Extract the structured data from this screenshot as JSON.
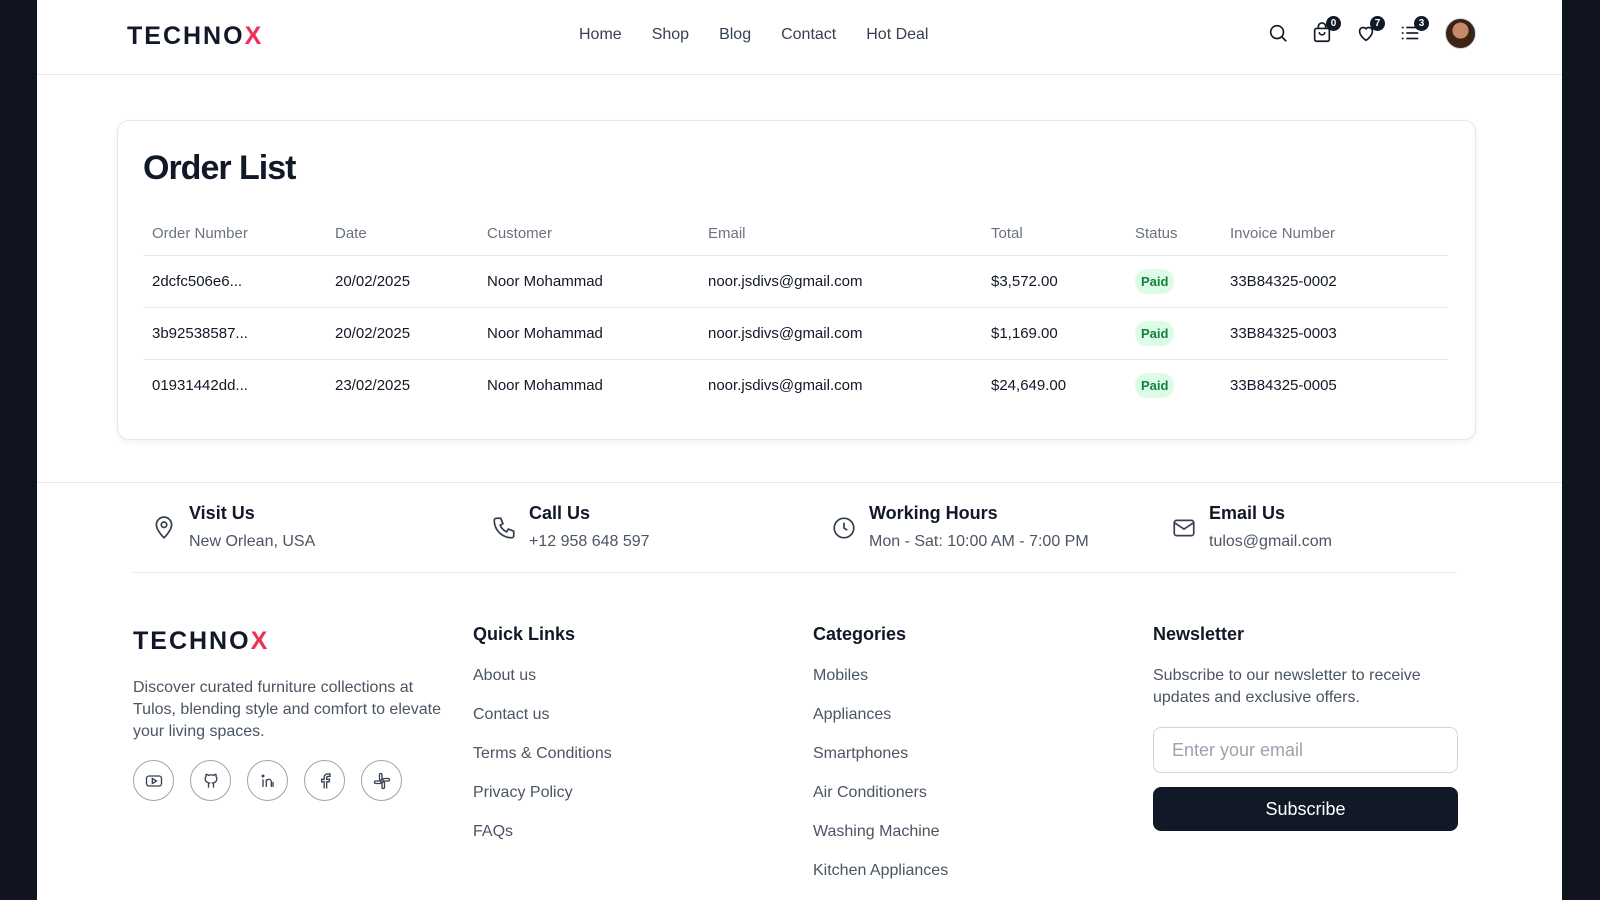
{
  "header": {
    "logo_main": "TECHNO",
    "logo_accent": "X",
    "nav": [
      "Home",
      "Shop",
      "Blog",
      "Contact",
      "Hot Deal"
    ],
    "cart_count": "0",
    "wishlist_count": "7",
    "compare_count": "3"
  },
  "orders": {
    "title": "Order List",
    "columns": [
      "Order Number",
      "Date",
      "Customer",
      "Email",
      "Total",
      "Status",
      "Invoice Number"
    ],
    "rows": [
      {
        "order": "2dcfc506e6...",
        "date": "20/02/2025",
        "customer": "Noor Mohammad",
        "email": "noor.jsdivs@gmail.com",
        "total": "$3,572.00",
        "status": "Paid",
        "invoice": "33B84325-0002"
      },
      {
        "order": "3b92538587...",
        "date": "20/02/2025",
        "customer": "Noor Mohammad",
        "email": "noor.jsdivs@gmail.com",
        "total": "$1,169.00",
        "status": "Paid",
        "invoice": "33B84325-0003"
      },
      {
        "order": "01931442dd...",
        "date": "23/02/2025",
        "customer": "Noor Mohammad",
        "email": "noor.jsdivs@gmail.com",
        "total": "$24,649.00",
        "status": "Paid",
        "invoice": "33B84325-0005"
      }
    ]
  },
  "contact": [
    {
      "title": "Visit Us",
      "value": "New Orlean, USA",
      "icon": "map-pin-icon"
    },
    {
      "title": "Call Us",
      "value": "+12 958 648 597",
      "icon": "phone-icon"
    },
    {
      "title": "Working Hours",
      "value": "Mon - Sat: 10:00 AM - 7:00 PM",
      "icon": "clock-icon"
    },
    {
      "title": "Email Us",
      "value": "tulos@gmail.com",
      "icon": "mail-icon"
    }
  ],
  "footer": {
    "logo_main": "TECHNO",
    "logo_accent": "X",
    "description": "Discover curated furniture collections at Tulos, blending style and comfort to elevate your living spaces.",
    "socials": [
      "youtube-icon",
      "github-icon",
      "linkedin-icon",
      "facebook-icon",
      "slack-icon"
    ],
    "quick_links_title": "Quick Links",
    "quick_links": [
      "About us",
      "Contact us",
      "Terms & Conditions",
      "Privacy Policy",
      "FAQs"
    ],
    "categories_title": "Categories",
    "categories": [
      "Mobiles",
      "Appliances",
      "Smartphones",
      "Air Conditioners",
      "Washing Machine",
      "Kitchen Appliances"
    ],
    "newsletter_title": "Newsletter",
    "newsletter_desc": "Subscribe to our newsletter to receive updates and exclusive offers.",
    "email_placeholder": "Enter your email",
    "subscribe_label": "Subscribe"
  },
  "colors": {
    "accent": "#ef2f56",
    "dark": "#111827",
    "paid_bg": "#dcfce7",
    "paid_text": "#15803d"
  }
}
